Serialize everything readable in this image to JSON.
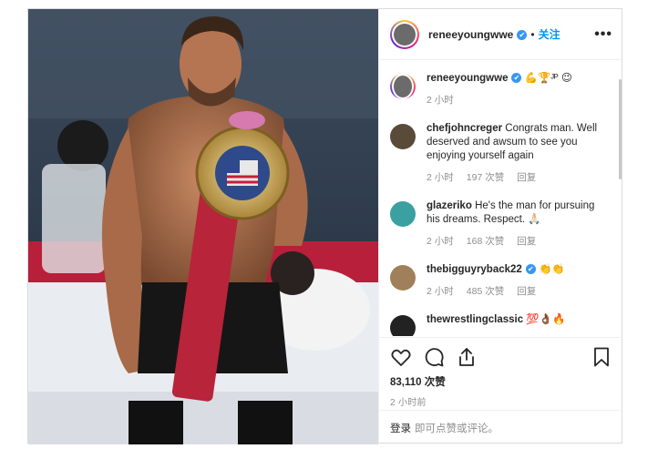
{
  "post": {
    "author": "reneeyoungwwe",
    "follow_label": "关注",
    "more_label": "•••",
    "verified_glyph": "✔",
    "dot": "•"
  },
  "comments": [
    {
      "user": "reneeyoungwwe",
      "text": "💪🏆ᴶᴾ 😉",
      "time": "2 小时",
      "likes": "",
      "reply": "",
      "verified": true,
      "avatar_color": "#6b6b6b"
    },
    {
      "user": "chefjohncreger",
      "text": "Congrats man. Well deserved and awsum to see you enjoying yourself again",
      "time": "2 小时",
      "likes": "197 次赞",
      "reply": "回复",
      "avatar_color": "#5a4a3a"
    },
    {
      "user": "glazeriko",
      "text": "He's the man for pursuing his dreams. Respect. 🙏🏻",
      "time": "2 小时",
      "likes": "168 次赞",
      "reply": "回复",
      "avatar_color": "#3aa0a0"
    },
    {
      "user": "thebigguyryback22",
      "text": "👏👏",
      "time": "2 小时",
      "likes": "485 次赞",
      "reply": "回复",
      "verified": true,
      "avatar_color": "#a0805a"
    },
    {
      "user": "thewrestlingclassic",
      "text": "💯👌🏾🔥",
      "time": "",
      "likes": "",
      "reply": "",
      "avatar_color": "#222222"
    }
  ],
  "actions": {
    "likes": "83,110 次赞",
    "time": "2 小时前"
  },
  "login": {
    "link": "登录",
    "text": "即可点赞或评论。"
  },
  "colors": {
    "accent": "#0095f6",
    "verified": "#3897f0",
    "muted": "#8e8e8e"
  }
}
